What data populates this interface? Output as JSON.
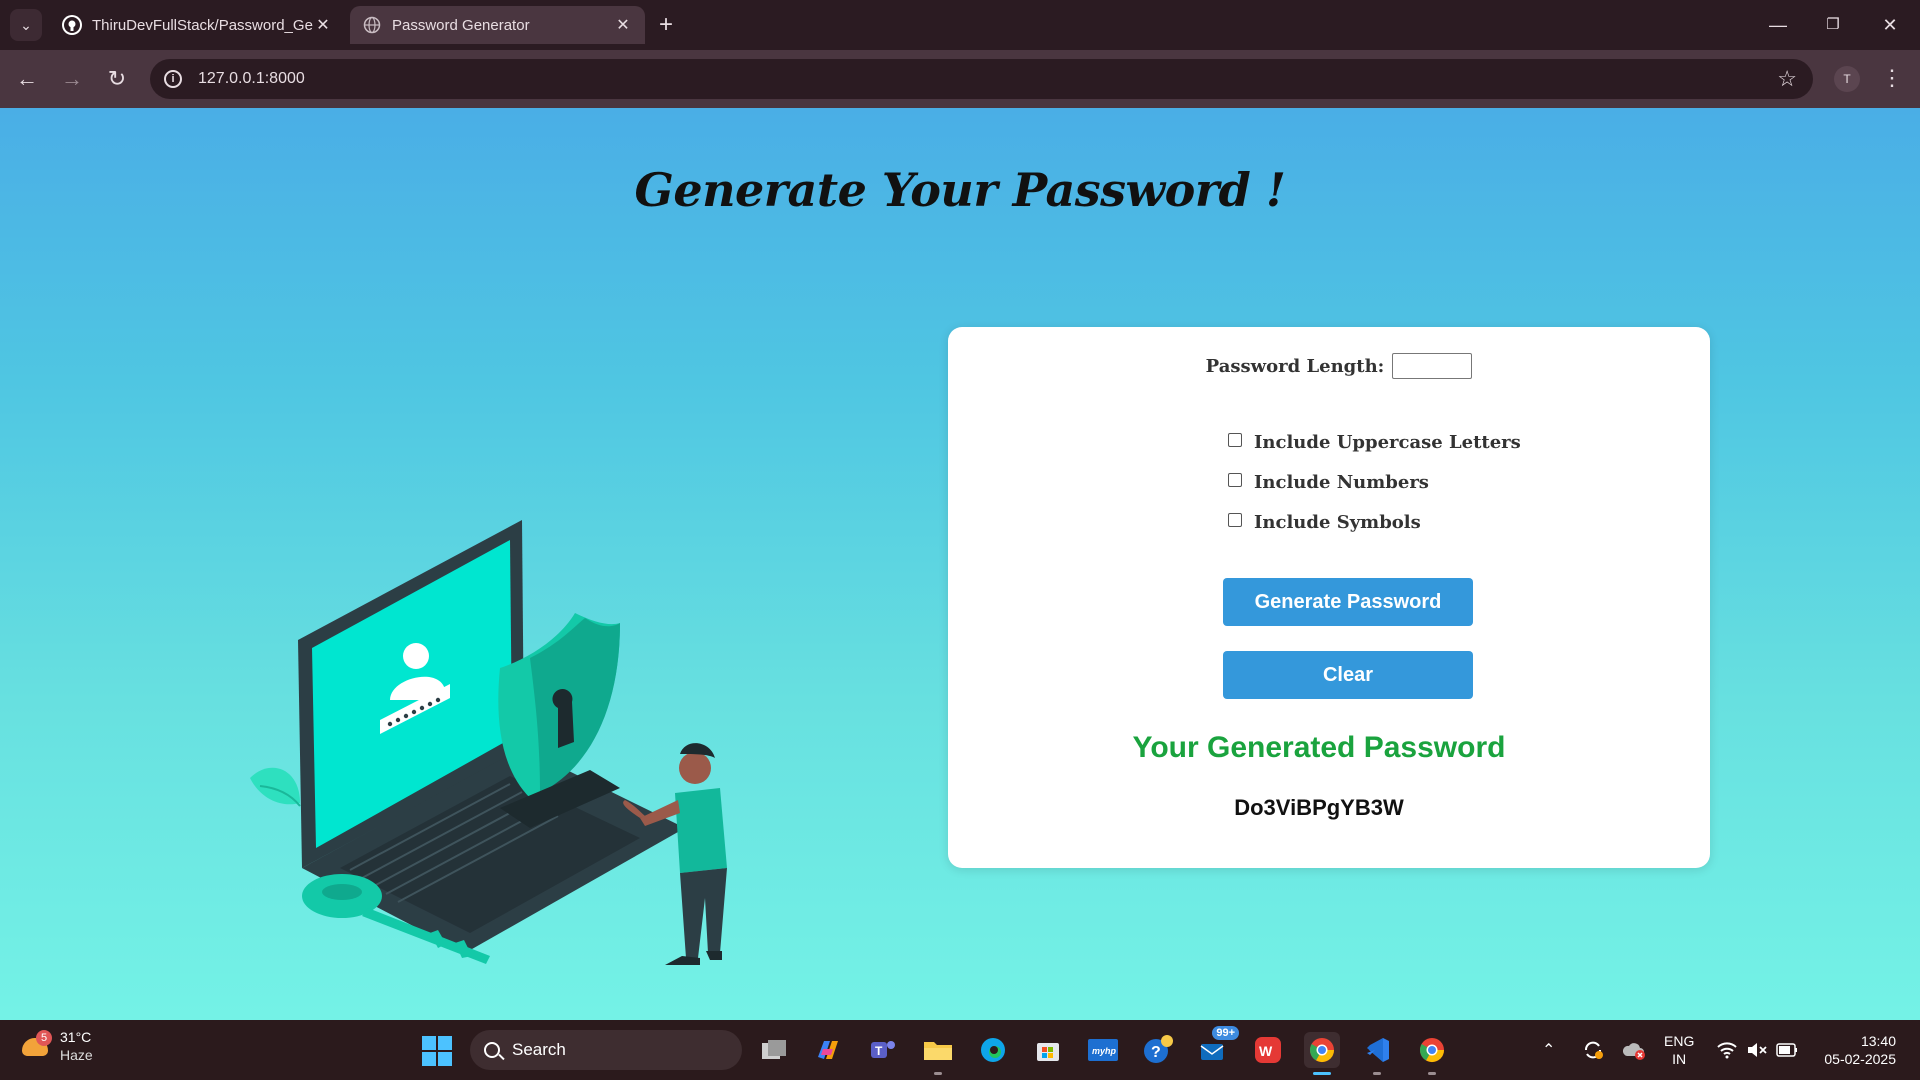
{
  "browser": {
    "tabs": [
      {
        "title": "ThiruDevFullStack/Password_Ge",
        "active": false
      },
      {
        "title": "Password Generator",
        "active": true
      }
    ],
    "new_tab": "+",
    "url": "127.0.0.1:8000",
    "profile_initial": "T"
  },
  "page": {
    "title": "Generate Your Password !",
    "length_label": "Password Length:",
    "length_value": "",
    "options": [
      {
        "label": "Include Uppercase Letters",
        "checked": false
      },
      {
        "label": "Include Numbers",
        "checked": false
      },
      {
        "label": "Include Symbols",
        "checked": false
      }
    ],
    "generate_label": "Generate Password",
    "clear_label": "Clear",
    "result_heading": "Your Generated Password",
    "result_value": "Do3ViBPgYB3W",
    "colors": {
      "button": "#3498db",
      "result_heading": "#1aa33e",
      "accent": "#11d6c0"
    }
  },
  "taskbar": {
    "weather": {
      "badge": "5",
      "temp": "31°C",
      "condition": "Haze"
    },
    "search_label": "Search",
    "mail_badge": "99+",
    "lang": [
      "ENG",
      "IN"
    ],
    "time": "13:40",
    "date": "05-02-2025"
  }
}
